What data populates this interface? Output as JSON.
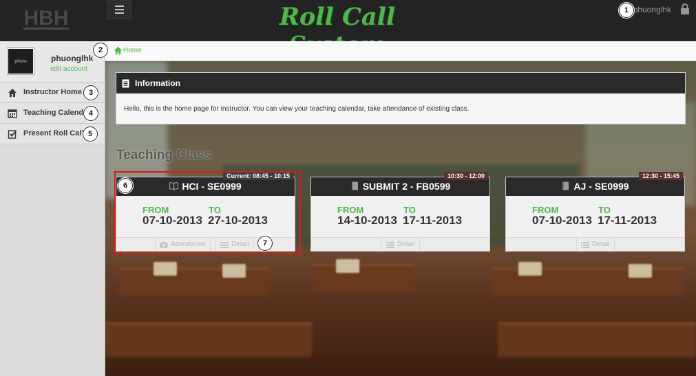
{
  "header": {
    "app_title": "Roll Call System",
    "username": "phuonglhk",
    "logo_text": "HBH"
  },
  "sidebar": {
    "avatar_label": "photo",
    "profile_name": "phuonglhk",
    "edit_account": "edit account",
    "items": [
      {
        "label": "Instructor Home",
        "icon": "home-icon"
      },
      {
        "label": "Teaching Calendar",
        "icon": "calendar-icon"
      },
      {
        "label": "Present Roll Call",
        "icon": "checklist-icon"
      }
    ]
  },
  "breadcrumb": {
    "home": "Home"
  },
  "info": {
    "title": "Information",
    "body": "Hello, this is the home page for instructor. You can view your teaching calendar, take attendance of existing class."
  },
  "teaching": {
    "section_title": "Teaching Class",
    "from_label": "FROM",
    "to_label": "TO",
    "attendance_label": "Attendance",
    "detail_label": "Detail",
    "classes": [
      {
        "name": "HCI - SE0999",
        "time": "Current: 08:45 - 10:15",
        "from": "07-10-2013",
        "to": "27-10-2013",
        "icon": "book-open-icon"
      },
      {
        "name": "SUBMIT 2 - FB0599",
        "time": "10:30 - 12:00",
        "from": "14-10-2013",
        "to": "17-11-2013",
        "icon": "book-icon"
      },
      {
        "name": "AJ - SE0999",
        "time": "12:30 - 15:45",
        "from": "07-10-2013",
        "to": "17-11-2013",
        "icon": "book-icon"
      }
    ]
  },
  "markers": [
    "1",
    "2",
    "3",
    "4",
    "5",
    "6",
    "7"
  ],
  "colors": {
    "accent_green": "#4cb74a",
    "header_dark": "#232323",
    "badge_red": "#5a3030",
    "highlight_red": "#d81c1c"
  }
}
